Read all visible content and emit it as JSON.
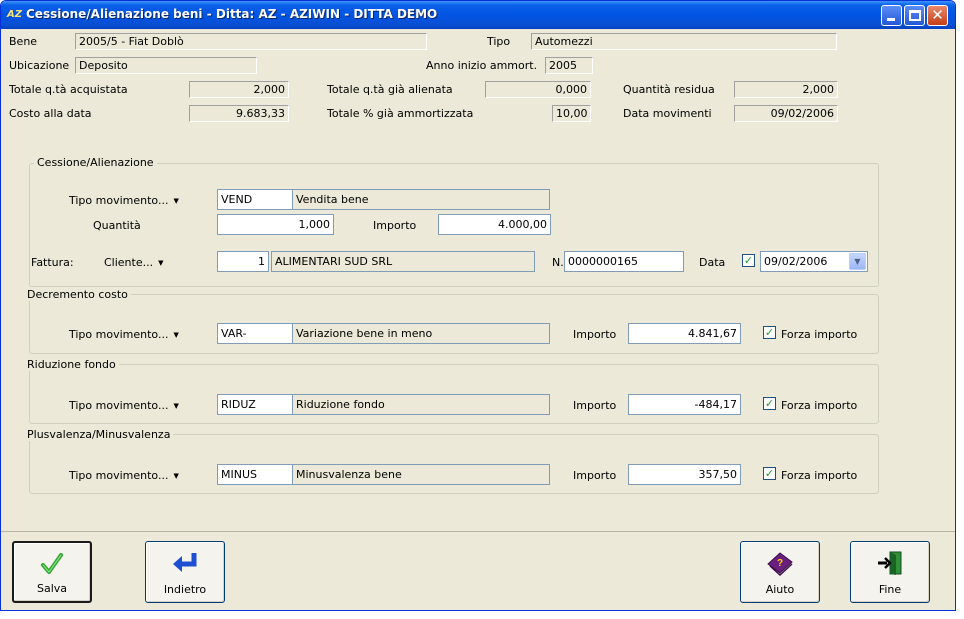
{
  "window": {
    "title": "Cessione/Alienazione beni - Ditta: AZ - AZIWIN - DITTA DEMO",
    "app_icon": "AZ"
  },
  "header": {
    "bene_label": "Bene",
    "bene_value": "2005/5 - Fiat Doblò",
    "tipo_label": "Tipo",
    "tipo_value": "Automezzi",
    "ubicazione_label": "Ubicazione",
    "ubicazione_value": "Deposito",
    "anno_label": "Anno inizio ammort.",
    "anno_value": "2005",
    "tot_acq_label": "Totale q.tà acquistata",
    "tot_acq_value": "2,000",
    "tot_alien_label": "Totale q.tà già alienata",
    "tot_alien_value": "0,000",
    "qta_res_label": "Quantità residua",
    "qta_res_value": "2,000",
    "costo_label": "Costo alla data",
    "costo_value": "9.683,33",
    "perc_label": "Totale % già ammortizzata",
    "perc_value": "10,00",
    "data_mov_label": "Data movimenti",
    "data_mov_value": "09/02/2006"
  },
  "cessione": {
    "title": "Cessione/Alienazione",
    "tipo_mov_label": "Tipo movimento...",
    "tipo_code": "VEND",
    "tipo_desc": "Vendita bene",
    "quantita_label": "Quantità",
    "quantita_value": "1,000",
    "importo_label": "Importo",
    "importo_value": "4.000,00",
    "fattura_label": "Fattura:",
    "cliente_label": "Cliente...",
    "cliente_code": "1",
    "cliente_name": "ALIMENTARI SUD SRL",
    "numero_label": "N.",
    "numero_value": "0000000165",
    "data_label": "Data",
    "data_value": "09/02/2006",
    "data_checked": true
  },
  "decremento": {
    "title": "Decremento costo",
    "tipo_mov_label": "Tipo movimento...",
    "tipo_code": "VAR-",
    "tipo_desc": "Variazione bene in meno",
    "importo_label": "Importo",
    "importo_value": "4.841,67",
    "forza_label": "Forza importo",
    "forza_checked": true
  },
  "riduzione": {
    "title": "Riduzione fondo",
    "tipo_mov_label": "Tipo movimento...",
    "tipo_code": "RIDUZ",
    "tipo_desc": "Riduzione fondo",
    "importo_label": "Importo",
    "importo_value": "-484,17",
    "forza_label": "Forza importo",
    "forza_checked": true
  },
  "plusminus": {
    "title": "Plusvalenza/Minusvalenza",
    "tipo_mov_label": "Tipo movimento...",
    "tipo_code": "MINUS",
    "tipo_desc": "Minusvalenza bene",
    "importo_label": "Importo",
    "importo_value": "357,50",
    "forza_label": "Forza importo",
    "forza_checked": true
  },
  "buttons": {
    "salva": "Salva",
    "indietro": "Indietro",
    "aiuto": "Aiuto",
    "fine": "Fine"
  },
  "icons": {
    "check": "checkmark-icon",
    "back": "back-arrow-icon",
    "help": "help-book-icon",
    "exit": "exit-door-icon",
    "dropdown": "dropdown-arrow-icon",
    "accent_green": "#2fa52f",
    "title_blue": "#0054e3"
  }
}
